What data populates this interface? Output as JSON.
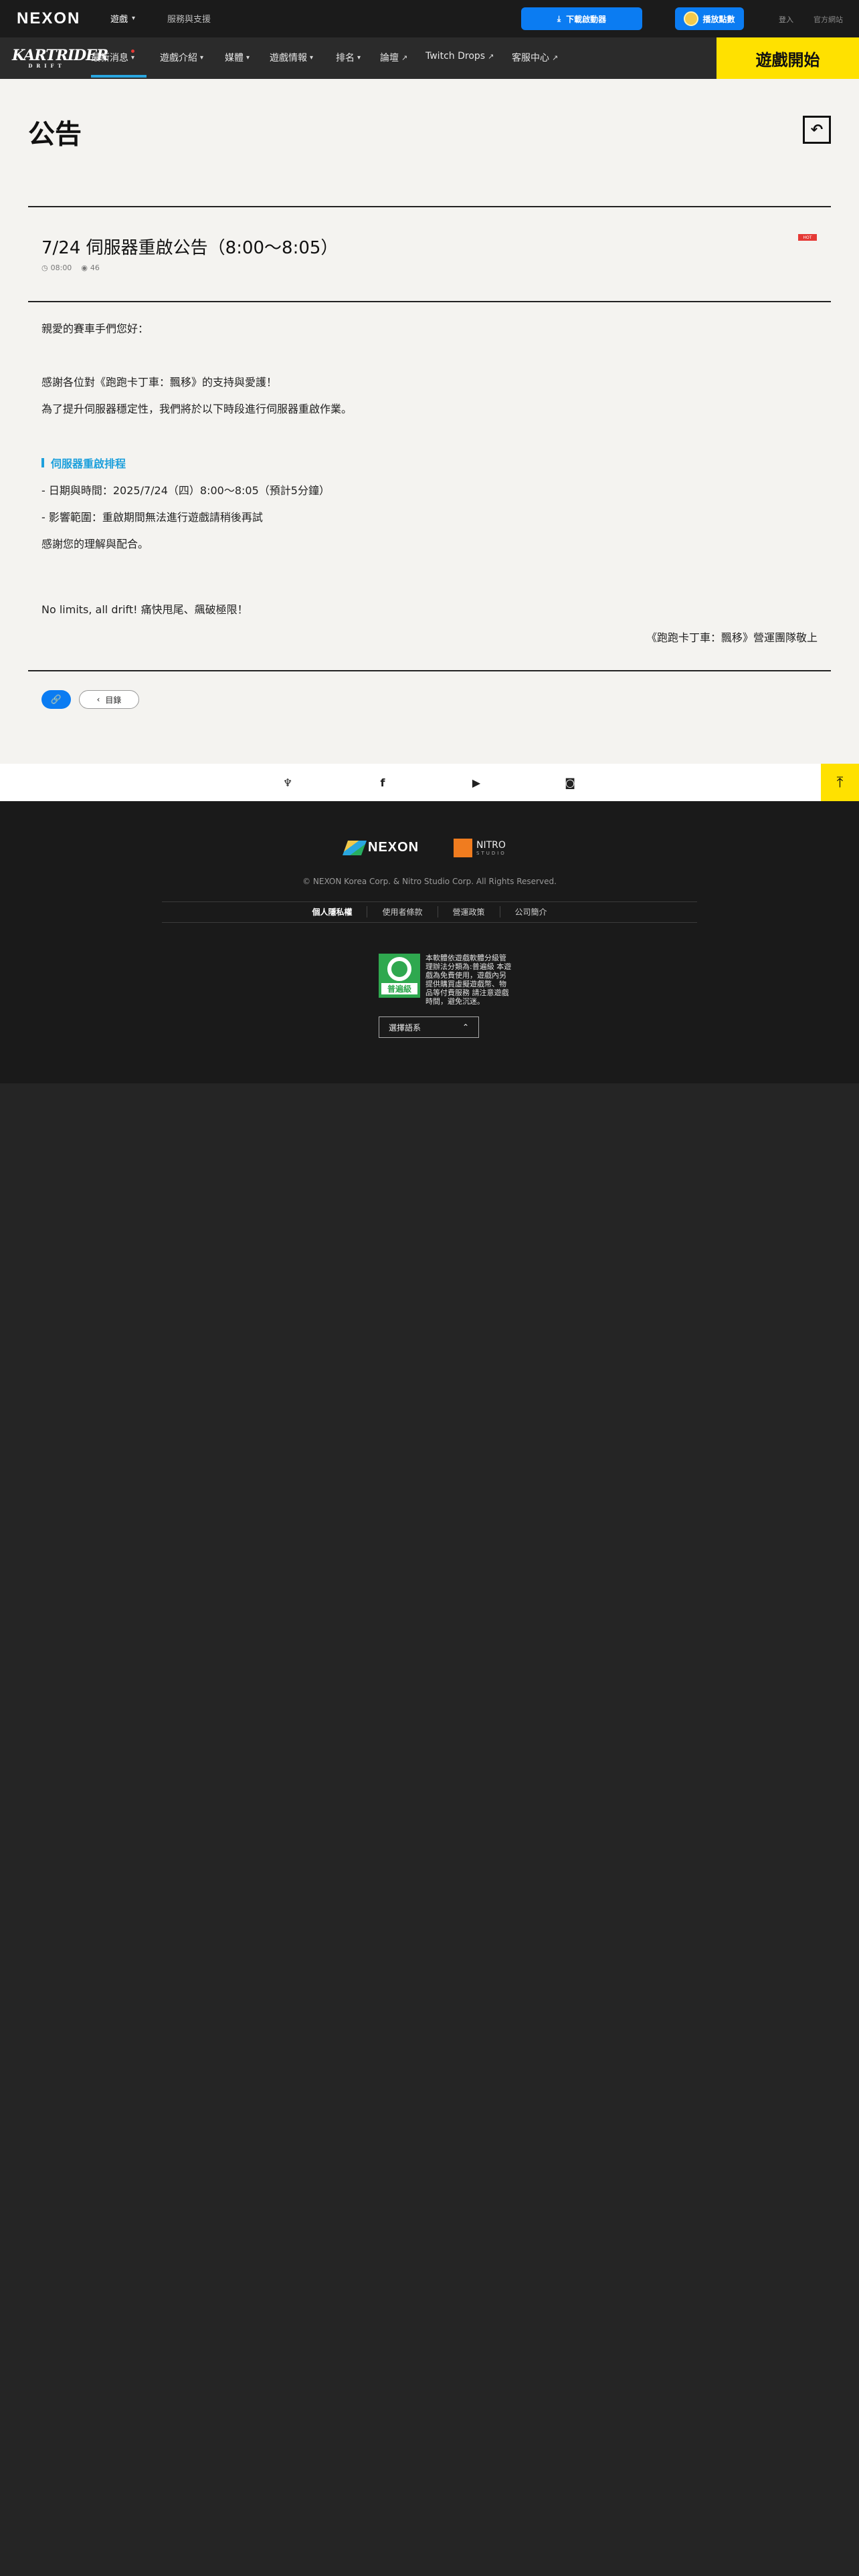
{
  "topbar": {
    "brand": "NEXON",
    "games_label": "遊戲",
    "support_label": "服務與支援",
    "download_label": "下載啟動器",
    "points_label": "播放點數",
    "login_label": "登入",
    "company_label": "官方網站"
  },
  "gamenav": {
    "logo_text": "KARTRIDER",
    "logo_sub": "DRIFT",
    "items": [
      {
        "label": "最新消息"
      },
      {
        "label": "遊戲介紹"
      },
      {
        "label": "媒體"
      },
      {
        "label": "遊戲情報"
      },
      {
        "label": "排名"
      },
      {
        "label": "論壇"
      },
      {
        "label": "Twitch Drops"
      },
      {
        "label": "客服中心"
      }
    ],
    "start_label": "遊戲開始"
  },
  "page": {
    "title": "公告"
  },
  "post": {
    "title": "7/24 伺服器重啟公告（8:00～8:05）",
    "badge": "HOT",
    "time": "08:00",
    "views": "46",
    "lines": [
      "親愛的賽車手們您好：",
      "感謝各位對《跑跑卡丁車：飄移》的支持與愛護！",
      "為了提升伺服器穩定性，我們將於以下時段進行伺服器重啟作業。",
      "伺服器重啟排程",
      "- 日期與時間：2025/7/24（四）8:00～8:05（預計5分鐘）",
      "- 影響範圍：重啟期間無法進行遊戲請稍後再試",
      "感謝您的理解與配合。",
      "No limits, all drift! 痛快甩尾、飆破極限！"
    ],
    "signature": "《跑跑卡丁車：飄移》營運團隊敬上",
    "list_label": "目錄"
  },
  "footer": {
    "nexon_brand": "NEXON",
    "nitro_brand": "NITRO",
    "nitro_sub": "STUDIO",
    "copyright": "© NEXON Korea Corp. & Nitro Studio Corp. All Rights Reserved.",
    "links": [
      "個人隱私權",
      "使用者條款",
      "營運政策",
      "公司簡介"
    ],
    "rating_label": "普遍級",
    "rating_text": "本軟體依遊戲軟體分級管理辦法分類為:普遍級 本遊戲為免費使用，遊戲內另提供購買虛擬遊戲幣、物品等付費服務 請注意遊戲時間，避免沉迷。",
    "region_label": "選擇語系"
  },
  "colors": {
    "accent_blue": "#0b7cf2",
    "start_yellow": "#ffe100",
    "heading_cyan": "#1ea0dc",
    "rating_green": "#2fa84f"
  }
}
